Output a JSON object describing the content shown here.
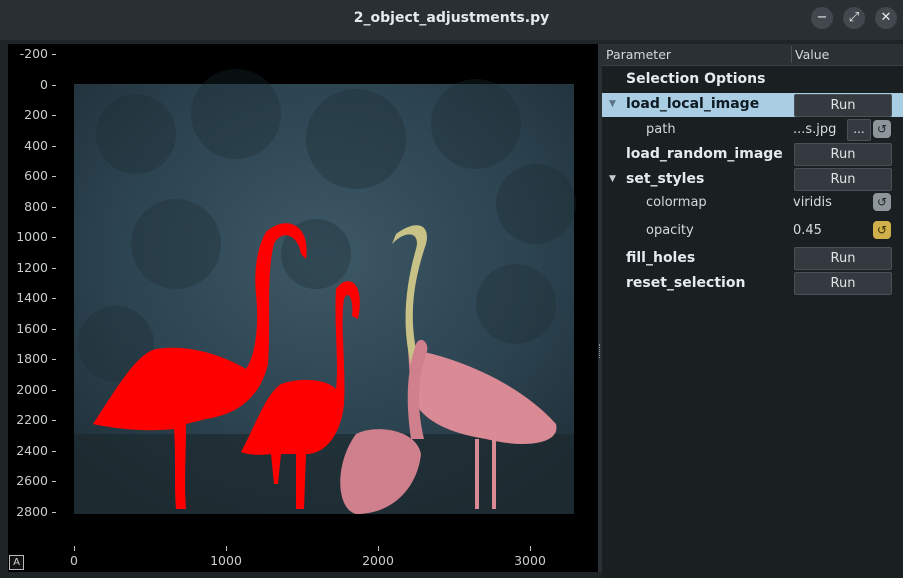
{
  "window": {
    "title": "2_object_adjustments.py",
    "buttons": [
      "−",
      "⤢",
      "✕"
    ]
  },
  "plot": {
    "y_ticks": [
      "-200",
      "0",
      "200",
      "400",
      "600",
      "800",
      "1000",
      "1200",
      "1400",
      "1600",
      "1800",
      "2000",
      "2200",
      "2400",
      "2600",
      "2800"
    ],
    "x_ticks": [
      "0",
      "1000",
      "2000",
      "3000"
    ],
    "corner_label": "A"
  },
  "panel": {
    "headers": {
      "param": "Parameter",
      "value": "Value"
    },
    "selection_options": "Selection Options",
    "load_local_image": {
      "label": "load_local_image",
      "button": "Run"
    },
    "path": {
      "label": "path",
      "value": "...s.jpg",
      "browse": "..."
    },
    "load_random_image": {
      "label": "load_random_image",
      "button": "Run"
    },
    "set_styles": {
      "label": "set_styles",
      "button": "Run"
    },
    "colormap": {
      "label": "colormap",
      "value": "viridis"
    },
    "opacity": {
      "label": "opacity",
      "value": "0.45"
    },
    "fill_holes": {
      "label": "fill_holes",
      "button": "Run"
    },
    "reset_selection": {
      "label": "reset_selection",
      "button": "Run"
    }
  },
  "colors": {
    "mask": "#ff0000",
    "selected_row": "#a9cde3",
    "image_tint": "#3a5063"
  }
}
